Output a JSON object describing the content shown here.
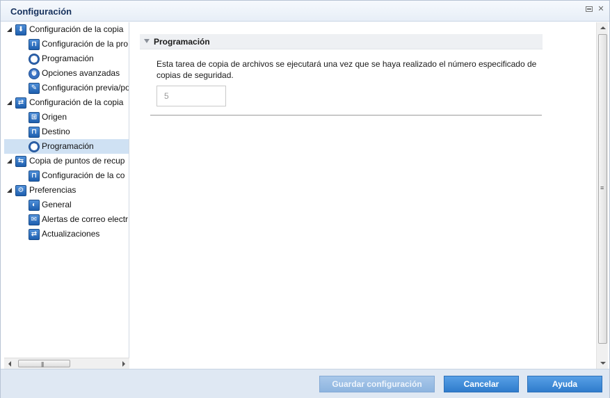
{
  "window": {
    "title": "Configuración"
  },
  "tree": {
    "items": [
      {
        "label": "Configuración de la copia",
        "level": 0,
        "expanded": true,
        "icon": "backup-settings-icon"
      },
      {
        "label": "Configuración de la pro",
        "level": 1,
        "icon": "protection-settings-icon"
      },
      {
        "label": "Programación",
        "level": 1,
        "icon": "schedule-clock-icon"
      },
      {
        "label": "Opciones avanzadas",
        "level": 1,
        "icon": "advanced-gears-icon"
      },
      {
        "label": "Configuración previa/po",
        "level": 1,
        "icon": "wrench-icon"
      },
      {
        "label": "Configuración de la copia",
        "level": 0,
        "expanded": true,
        "icon": "file-copy-settings-icon"
      },
      {
        "label": "Origen",
        "level": 1,
        "icon": "source-network-icon"
      },
      {
        "label": "Destino",
        "level": 1,
        "icon": "destination-icon"
      },
      {
        "label": "Programación",
        "level": 1,
        "icon": "schedule-clock-icon",
        "selected": true
      },
      {
        "label": "Copia de puntos de recup",
        "level": 0,
        "expanded": true,
        "icon": "recovery-point-copy-icon"
      },
      {
        "label": "Configuración de la co",
        "level": 1,
        "icon": "copy-settings-icon"
      },
      {
        "label": "Preferencias",
        "level": 0,
        "expanded": true,
        "icon": "preferences-icon"
      },
      {
        "label": "General",
        "level": 1,
        "icon": "globe-icon"
      },
      {
        "label": "Alertas de correo electr",
        "level": 1,
        "icon": "email-icon"
      },
      {
        "label": "Actualizaciones",
        "level": 1,
        "icon": "updates-arrows-icon"
      }
    ]
  },
  "section": {
    "title": "Programación",
    "description": "Esta tarea de copia de archivos se ejecutará una vez que se haya realizado el número especificado de copias de seguridad.",
    "backup_count_value": "5"
  },
  "footer": {
    "save_label": "Guardar configuración",
    "cancel_label": "Cancelar",
    "help_label": "Ayuda"
  },
  "colors": {
    "accent": "#2f7ccc",
    "selection": "#cfe1f3",
    "title_text": "#15305c",
    "footer_bg": "#dfe8f3"
  }
}
